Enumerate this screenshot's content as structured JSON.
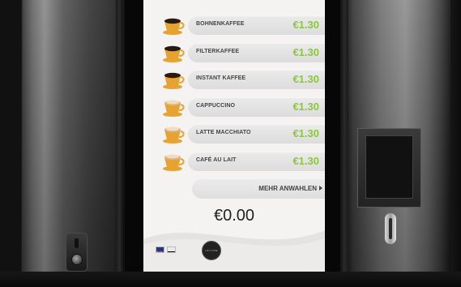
{
  "menu": {
    "items": [
      {
        "name": "BOHNENKAFFEE",
        "price": "€1.30",
        "cup": "black-coffee"
      },
      {
        "name": "FILTERKAFFEE",
        "price": "€1.30",
        "cup": "black-coffee"
      },
      {
        "name": "INSTANT KAFFEE",
        "price": "€1.30",
        "cup": "black-coffee"
      },
      {
        "name": "CAPPUCCINO",
        "price": "€1.30",
        "cup": "milk-coffee"
      },
      {
        "name": "LATTE MACCHIATO",
        "price": "€1.30",
        "cup": "milk-coffee"
      },
      {
        "name": "CAFÉ AU LAIT",
        "price": "€1.30",
        "cup": "milk-coffee"
      }
    ],
    "more_label": "MEHR ANWAHLEN"
  },
  "total": "€0.00",
  "languages": [
    "en-flag-icon",
    "de-flag-icon"
  ],
  "code_button_label": "LIFT CODE",
  "colors": {
    "price": "#8cc63f",
    "cup": "#e8a230",
    "coffee_dark": "#2a1a10",
    "milk_foam": "#d9b48a"
  }
}
